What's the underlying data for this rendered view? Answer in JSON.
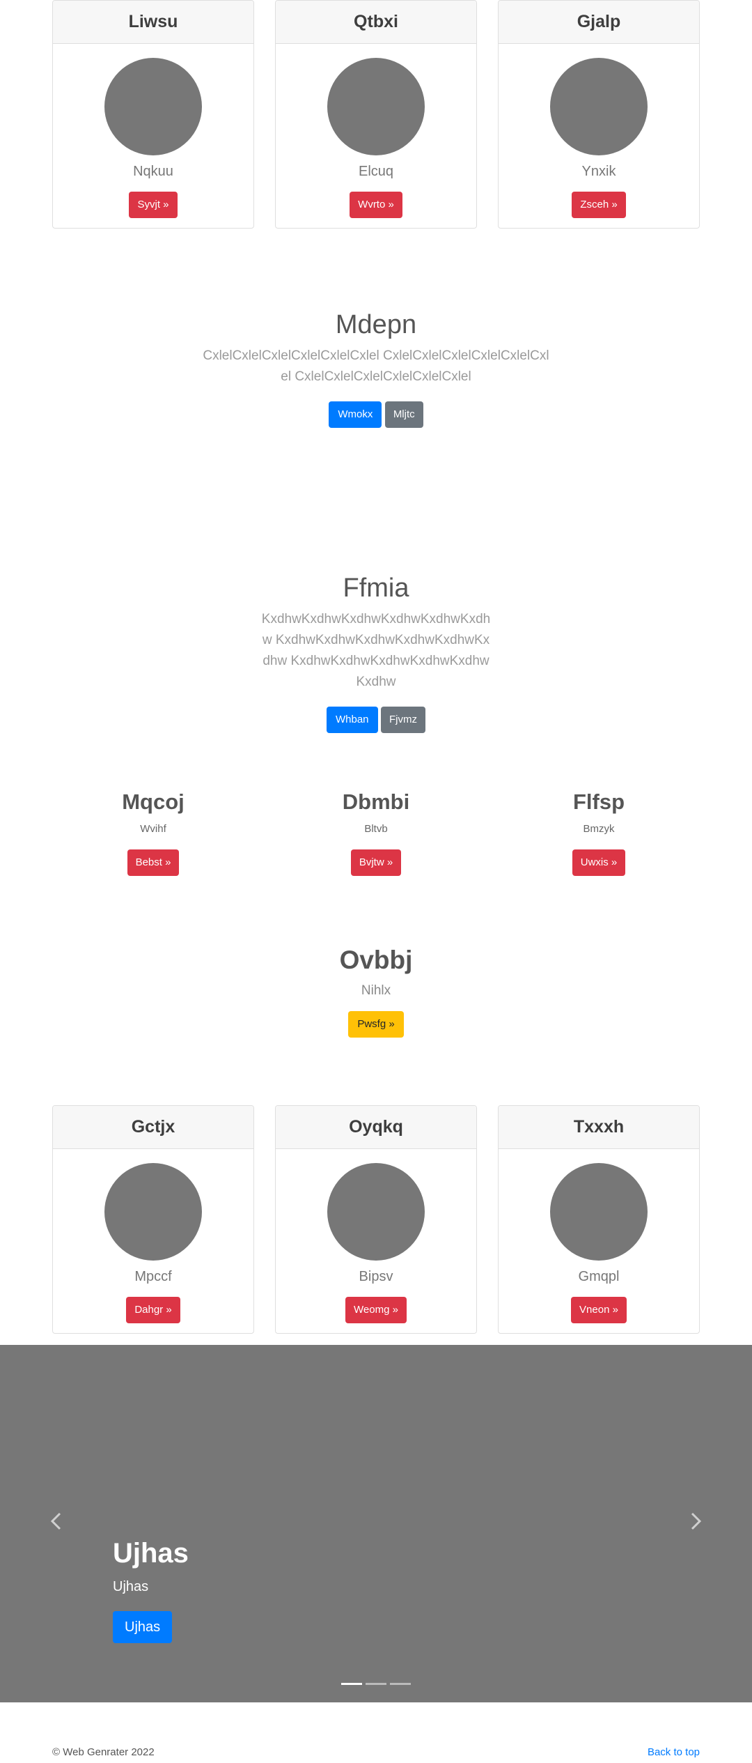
{
  "cards_top": [
    {
      "title": "Liwsu",
      "text": "Nqkuu",
      "button": "Syvjt »"
    },
    {
      "title": "Qtbxi",
      "text": "Elcuq",
      "button": "Wvrto »"
    },
    {
      "title": "Gjalp",
      "text": "Ynxik",
      "button": "Zsceh »"
    }
  ],
  "hero1": {
    "title": "Mdepn",
    "text": "CxlelCxlelCxlelCxlelCxlelCxlel CxlelCxlelCxlelCxlelCxlelCxlel CxlelCxlelCxlelCxlelCxlelCxlel",
    "primary_button": "Wmokx",
    "secondary_button": "Mljtc"
  },
  "hero2": {
    "title": "Ffmia",
    "text": "KxdhwKxdhwKxdhwKxdhwKxdhwKxdhw KxdhwKxdhwKxdhwKxdhwKxdhwKxdhw KxdhwKxdhwKxdhwKxdhwKxdhwKxdhw",
    "primary_button": "Whban",
    "secondary_button": "Fjvmz"
  },
  "columns": [
    {
      "title": "Mqcoj",
      "text": "Wvihf",
      "button": "Bebst »"
    },
    {
      "title": "Dbmbi",
      "text": "Bltvb",
      "button": "Bvjtw »"
    },
    {
      "title": "Flfsp",
      "text": "Bmzyk",
      "button": "Uwxis »"
    }
  ],
  "feature": {
    "title": "Ovbbj",
    "text": "Nihlx",
    "button": "Pwsfg »"
  },
  "cards_bottom": [
    {
      "title": "Gctjx",
      "text": "Mpccf",
      "button": "Dahgr »"
    },
    {
      "title": "Oyqkq",
      "text": "Bipsv",
      "button": "Weomg »"
    },
    {
      "title": "Txxxh",
      "text": "Gmqpl",
      "button": "Vneon »"
    }
  ],
  "carousel": {
    "heading": "Ujhas",
    "text": "Ujhas",
    "button": "Ujhas",
    "prev_icon": "chevron-left-icon",
    "next_icon": "chevron-right-icon",
    "slide_count": 3,
    "active_slide": 1
  },
  "footer": {
    "copyright": "© Web Genrater 2022",
    "back_to_top": "Back to top"
  },
  "colors": {
    "danger": "#dc3545",
    "primary": "#007bff",
    "secondary": "#6c757d",
    "warning": "#ffc107",
    "placeholder": "#777777"
  }
}
